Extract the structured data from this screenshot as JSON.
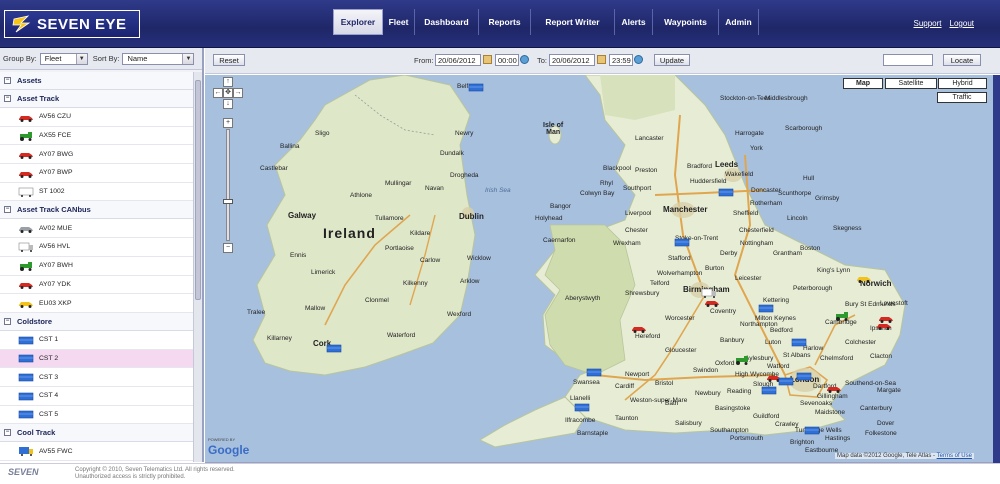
{
  "header": {
    "logo_text": "SEVEN EYE",
    "nav": [
      "Explorer",
      "Fleet",
      "Dashboard",
      "Reports",
      "Report Writer",
      "Alerts",
      "Waypoints",
      "Admin"
    ],
    "active_tab": "Explorer",
    "links": {
      "support": "Support",
      "logout": "Logout"
    }
  },
  "sidebar": {
    "group_by_label": "Group By:",
    "group_by_value": "Fleet",
    "sort_by_label": "Sort By:",
    "sort_by_value": "Name",
    "root": "Assets",
    "groups": [
      {
        "name": "Asset Track",
        "items": [
          {
            "label": "AV56 CZU",
            "icon": "red-car-icon"
          },
          {
            "label": "AX55 FCE",
            "icon": "green-tractor-icon"
          },
          {
            "label": "AY07 BWG",
            "icon": "red-car-icon"
          },
          {
            "label": "AY07 BWP",
            "icon": "red-car-icon"
          },
          {
            "label": "ST 1002",
            "icon": "white-trailer-icon"
          }
        ]
      },
      {
        "name": "Asset Track CANbus",
        "items": [
          {
            "label": "AV02 MUE",
            "icon": "grey-car-icon"
          },
          {
            "label": "AV56 HVL",
            "icon": "white-truck-icon"
          },
          {
            "label": "AY07 BWH",
            "icon": "green-tractor-icon"
          },
          {
            "label": "AY07 YDK",
            "icon": "red-car-icon"
          },
          {
            "label": "EU03 XKP",
            "icon": "yellow-car-icon"
          }
        ]
      },
      {
        "name": "Coldstore",
        "items": [
          {
            "label": "CST 1",
            "icon": "blue-container-icon"
          },
          {
            "label": "CST 2",
            "icon": "blue-container-icon",
            "selected": true
          },
          {
            "label": "CST 3",
            "icon": "blue-container-icon"
          },
          {
            "label": "CST 4",
            "icon": "blue-container-icon"
          },
          {
            "label": "CST 5",
            "icon": "blue-container-icon"
          }
        ]
      },
      {
        "name": "Cool Track",
        "items": [
          {
            "label": "AV55 FWC",
            "icon": "yellow-truck-icon"
          }
        ]
      }
    ]
  },
  "toolbar": {
    "reset_label": "Reset",
    "from_label": "From:",
    "from_date": "20/06/2012",
    "from_time": "00:00",
    "to_label": "To:",
    "to_date": "20/06/2012",
    "to_time": "23:59",
    "update_label": "Update",
    "locate_label": "Locate",
    "locate_value": ""
  },
  "map": {
    "types": [
      "Map",
      "Satellite",
      "Hybrid"
    ],
    "active_type": "Map",
    "traffic_label": "Traffic",
    "attribution": "Map data ©2012 Google, Tele Atlas -",
    "terms": "Terms of Use",
    "powered_by": "POWERED BY",
    "google": "Google",
    "labels": {
      "ireland": "Ireland",
      "belfast": "Belfast",
      "isle_of_man": "Isle of\nMan",
      "irish_sea": "Irish Sea",
      "dublin": "Dublin",
      "galway": "Galway",
      "limerick": "Limerick",
      "kilkenny": "Kilkenny",
      "wexford": "Wexford",
      "cork": "Cork",
      "waterford": "Waterford",
      "leeds": "Leeds",
      "manchester": "Manchester",
      "liverpool": "Liverpool",
      "sheffield": "Sheffield",
      "stoke": "Stoke-on-Trent",
      "birmingham": "Birmingham",
      "coventry": "Coventry",
      "northampton": "Northampton",
      "cambridge": "Cambridge",
      "norwich": "Norwich",
      "colchester": "Colchester",
      "london": "London",
      "st_albans": "St Albans",
      "swansea": "Swansea",
      "cardiff": "Cardiff",
      "bristol": "Bristol",
      "reading": "Reading",
      "southend": "Southend-on-Sea",
      "brighton": "Brighton",
      "blackpool": "Blackpool",
      "preston": "Preston",
      "carnarfon": "Caernarfon",
      "aberystwyth": "Aberystwyth",
      "hereford": "Hereford",
      "gloucester": "Gloucester",
      "oxford": "Oxford",
      "luton": "Luton",
      "york": "York",
      "hull": "Hull",
      "lincoln": "Lincoln",
      "nottingham": "Nottingham",
      "leicester": "Leicester",
      "peterborough": "Peterborough",
      "ipswich": "Ipswich",
      "canterbury": "Canterbury",
      "dover": "Dover",
      "guildford": "Guildford",
      "stockton": "Stockton-on-Tees",
      "middlesbrough": "Middlesbrough",
      "drogheda": "Drogheda",
      "athlone": "Athlone",
      "sligo": "Sligo",
      "clonmel": "Clonmel",
      "tralee": "Tralee",
      "killarney": "Killarney",
      "ennis": "Ennis",
      "carlow": "Carlow",
      "holyhead": "Holyhead",
      "wrexham": "Wrexham",
      "chester": "Chester",
      "worcester": "Worcester",
      "bath": "Bath",
      "swindon": "Swindon",
      "milton_keynes": "Milton Keynes",
      "bedford": "Bedford",
      "chelmsford": "Chelmsford",
      "maidstone": "Maidstone",
      "crawley": "Crawley",
      "southampton": "Southampton",
      "portsmouth": "Portsmouth",
      "lowestoft": "Lowestoft",
      "derby": "Derby",
      "huddersfield": "Huddersfield",
      "bradford": "Bradford",
      "harrogate": "Harrogate",
      "scarborough": "Scarborough",
      "lancaster": "Lancaster",
      "newry": "Newry",
      "dundalk": "Dundalk",
      "navan": "Navan",
      "arklow": "Arklow",
      "kildare": "Kildare",
      "mullingar": "Mullingar",
      "tullamore": "Tullamore",
      "portlaoise": "Portlaoise",
      "ballina": "Ballina",
      "castlebar": "Castlebar",
      "mallow": "Mallow",
      "wicklow": "Wicklow",
      "newport": "Newport",
      "llanelli": "Llanelli",
      "bangor": "Bangor",
      "weston": "Weston-super-Mare",
      "taunton": "Taunton",
      "ilfracombe": "Ilfracombe",
      "barnstaple": "Barnstaple",
      "gillingham": "Gillingham",
      "slough": "Slough",
      "harlow": "Harlow",
      "colwyn": "Colwyn Bay",
      "rhyl": "Rhyl",
      "telford": "Telford",
      "shrewsbury": "Shrewsbury",
      "wolverhampton": "Wolverhampton",
      "kettering": "Kettering",
      "kings_lynn": "King's Lynn",
      "grantham": "Grantham",
      "doncaster": "Doncaster",
      "wakefield": "Wakefield",
      "boston": "Boston",
      "bury": "Bury St Edmunds",
      "clacton": "Clacton",
      "southport": "Southport",
      "scunthorpe": "Scunthorpe",
      "grimsby": "Grimsby",
      "skegness": "Skegness",
      "rotherham": "Rotherham",
      "chesterfield": "Chesterfield",
      "stafford": "Stafford",
      "burton": "Burton",
      "banbury": "Banbury",
      "aylesbury": "Aylesbury",
      "watford": "Watford",
      "high_wycombe": "High Wycombe",
      "basingstoke": "Basingstoke",
      "newbury": "Newbury",
      "salisbury": "Salisbury",
      "hastings": "Hastings",
      "eastbourne": "Eastbourne",
      "margate": "Margate",
      "folkestone": "Folkestone",
      "tunbridge": "Tunbridge Wells",
      "sevenoaks": "Sevenoaks",
      "dartford": "Dartford"
    }
  },
  "footer": {
    "logo": "SEVEN",
    "copyright": "Copyright © 2010, Seven Telematics Ltd. All rights reserved.",
    "warning": "Unauthorized access is strictly prohibited."
  }
}
